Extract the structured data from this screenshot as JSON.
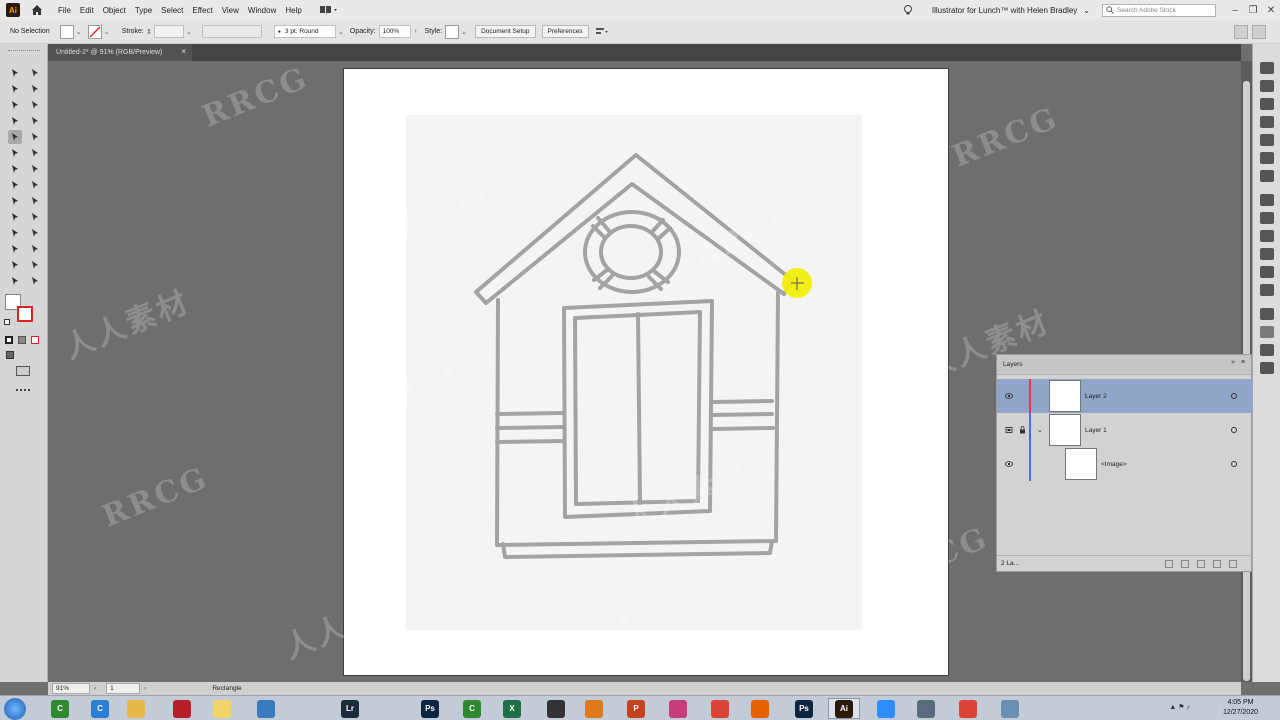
{
  "app": {
    "logo_text": "Ai",
    "menus": [
      "File",
      "Edit",
      "Object",
      "Type",
      "Select",
      "Effect",
      "View",
      "Window",
      "Help"
    ],
    "workspace_title": "Illustrator for Lunch™ with Helen Bradley",
    "search_placeholder": "Search Adobe Stock"
  },
  "control_bar": {
    "selection_label": "No Selection",
    "stroke_label": "Stroke:",
    "brush_value": "3 pt. Round",
    "opacity_label": "Opacity:",
    "opacity_value": "100%",
    "style_label": "Style:",
    "document_setup_button": "Document Setup",
    "preferences_button": "Preferences"
  },
  "document": {
    "tab_title": "Untitled-2* @ 91% (RGB/Preview)",
    "close_glyph": "×"
  },
  "layers_panel": {
    "title": "Layers",
    "menu_glyph": "≡",
    "collapse_glyph": "»",
    "layers": [
      {
        "name": "Layer 2",
        "color": "#e33a4b",
        "selected": true
      },
      {
        "name": "Layer 1",
        "color": "#4b6fe0",
        "locked": true,
        "expanded": true
      },
      {
        "name": "<Image>",
        "sublayer": true
      }
    ],
    "footer_text": "2 La..."
  },
  "status_bar": {
    "zoom": "91%",
    "artboard_number": "1",
    "current_tool": "Rectangle"
  },
  "taskbar": {
    "apps": [
      {
        "name": "camtasia",
        "color": "#2f8a2f",
        "label": "C"
      },
      {
        "name": "chrome-dev",
        "color": "#2d7fd6",
        "label": "C"
      },
      {
        "name": "file-explorer",
        "color": "#e6b84a",
        "label": ""
      },
      {
        "name": "calculator",
        "color": "#b51f2a",
        "label": ""
      },
      {
        "name": "notepad",
        "color": "#f0d46a",
        "label": ""
      },
      {
        "name": "globe",
        "color": "#3a7bbf",
        "label": ""
      },
      {
        "name": "lightroom",
        "color": "#1c2a3d",
        "label": "Lr"
      },
      {
        "name": "photoshop",
        "color": "#0c2540",
        "label": "Ps"
      },
      {
        "name": "camtasia-2",
        "color": "#2f8a2f",
        "label": "C"
      },
      {
        "name": "excel",
        "color": "#1e7145",
        "label": "X"
      },
      {
        "name": "ps-express",
        "color": "#333333",
        "label": ""
      },
      {
        "name": "search-app",
        "color": "#e07a18",
        "label": ""
      },
      {
        "name": "powerpoint",
        "color": "#c2431c",
        "label": "P"
      },
      {
        "name": "paint",
        "color": "#c93c7a",
        "label": ""
      },
      {
        "name": "chrome",
        "color": "#db4437",
        "label": ""
      },
      {
        "name": "firefox",
        "color": "#e66000",
        "label": ""
      },
      {
        "name": "photoshop-2",
        "color": "#0c2540",
        "label": "Ps"
      },
      {
        "name": "illustrator",
        "color": "#2b1a0a",
        "label": "Ai"
      },
      {
        "name": "zoom",
        "color": "#2d8cff",
        "label": ""
      },
      {
        "name": "pen-app",
        "color": "#5a6b7d",
        "label": ""
      },
      {
        "name": "chrome-2",
        "color": "#db4437",
        "label": ""
      },
      {
        "name": "screen",
        "color": "#6a8fb5",
        "label": ""
      }
    ],
    "time": "4:05 PM",
    "date": "12/27/2020"
  },
  "watermarks": {
    "latin": "RRCG",
    "cjk": "人人素材"
  }
}
